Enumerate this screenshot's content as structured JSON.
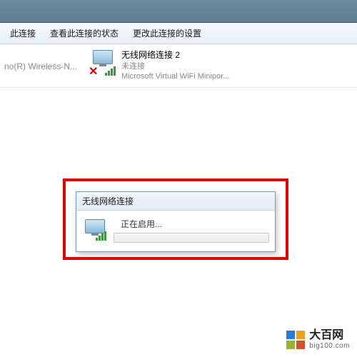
{
  "toolbar": {
    "items": [
      {
        "label": "此连接"
      },
      {
        "label": "查看此连接的状态"
      },
      {
        "label": "更改此连接的设置"
      }
    ]
  },
  "connections": {
    "left_partial": "no(R) Wireless-N...",
    "right": {
      "name": "无线网络连接 2",
      "status": "未连接",
      "device": "Microsoft Virtual WiFi Minipor..."
    }
  },
  "dialog": {
    "title": "无线网络连接",
    "body_text": "正在启用..."
  },
  "watermark": {
    "cn": "大百网",
    "en": "big100.com"
  }
}
